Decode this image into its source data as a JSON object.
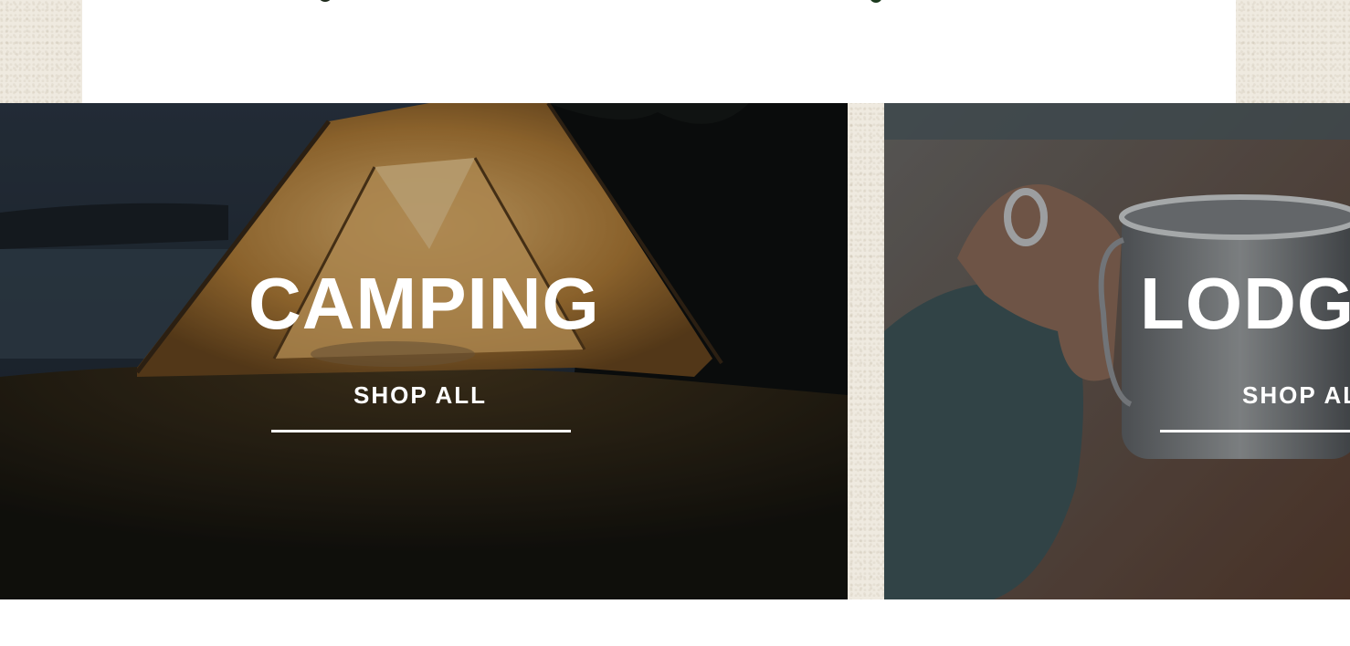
{
  "categories": [
    {
      "title": "CAMPING",
      "cta": "SHOP ALL",
      "image": "tent-at-night-photo"
    },
    {
      "title": "LODGE",
      "cta": "SHOP ALL",
      "image": "steel-camp-mug-photo"
    }
  ],
  "colors": {
    "page_background": "#efeae0",
    "card_background": "#ffffff",
    "text_on_image": "#ffffff",
    "tent_glow": "#c8913a"
  }
}
